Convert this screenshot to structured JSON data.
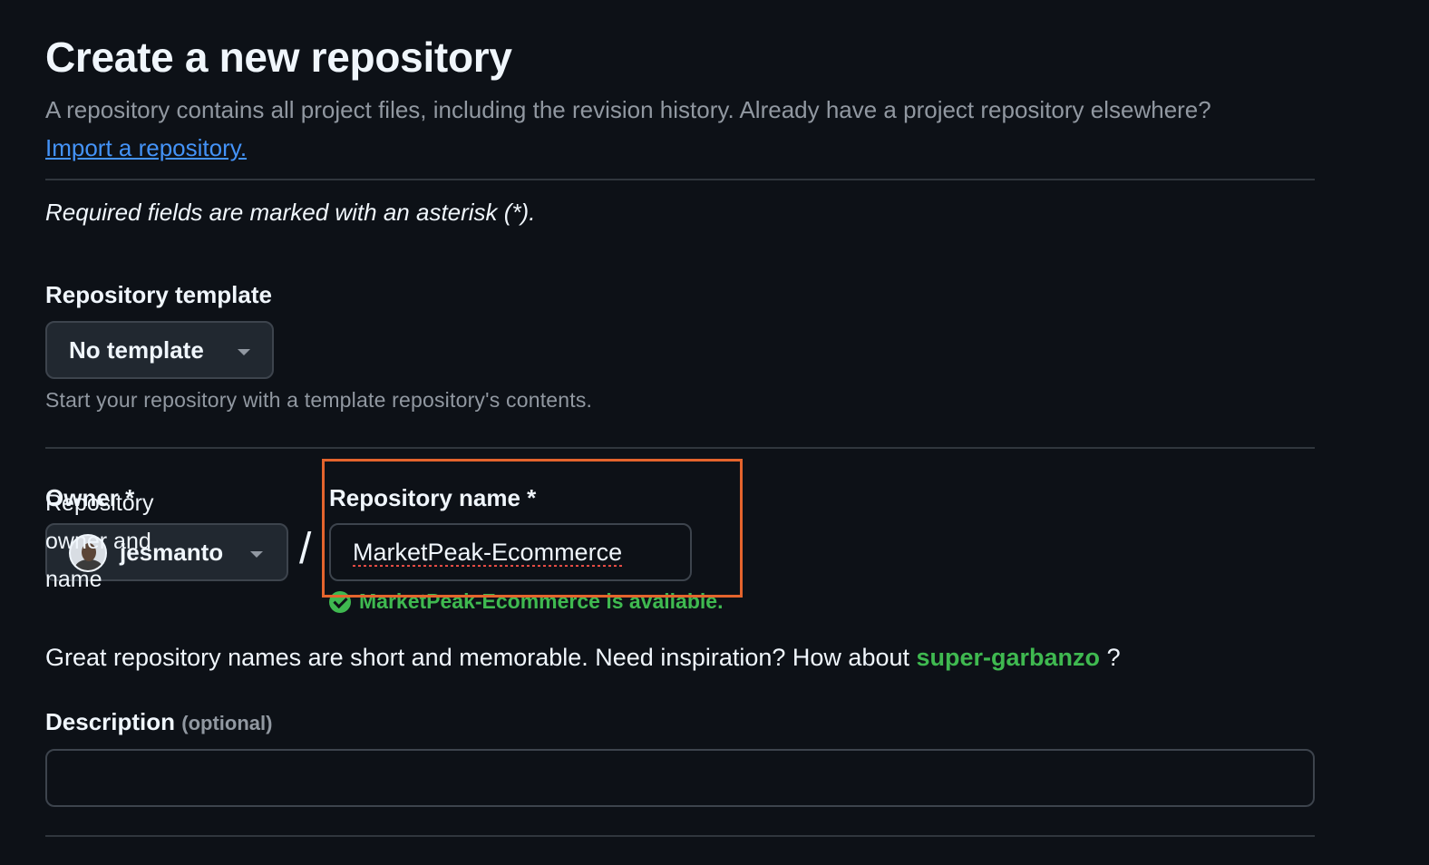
{
  "header": {
    "title": "Create a new repository",
    "intro_text": "A repository contains all project files, including the revision history. Already have a project repository elsewhere?",
    "import_link": "Import a repository."
  },
  "form": {
    "required_note": "Required fields are marked with an asterisk (*).",
    "template": {
      "label": "Repository template",
      "selected": "No template",
      "help": "Start your repository with a template repository's contents."
    },
    "owner": {
      "label": "Owner *",
      "overlay_label": "Repository owner and name",
      "selected": "jesmanto",
      "separator": "/"
    },
    "repo_name": {
      "label": "Repository name *",
      "value": "MarketPeak-Ecommerce",
      "availability": "MarketPeak-Ecommerce is available."
    },
    "suggestion": {
      "prefix": "Great repository names are short and memorable. Need inspiration? How about",
      "name": "super-garbanzo",
      "suffix": "?"
    },
    "description": {
      "label": "Description",
      "optional": "(optional)",
      "value": ""
    }
  },
  "colors": {
    "background": "#0d1117",
    "link": "#4493f8",
    "success": "#3fb950",
    "highlight": "#e4642d"
  }
}
